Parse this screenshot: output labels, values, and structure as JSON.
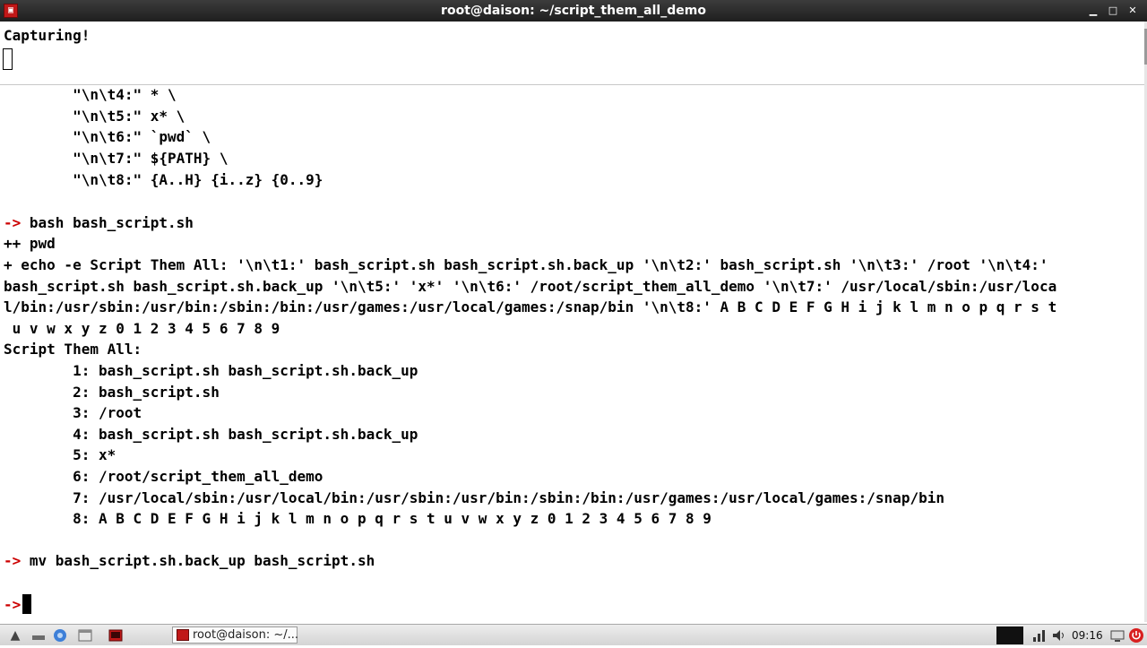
{
  "window": {
    "title": "root@daison: ~/script_them_all_demo",
    "min_glyph": "▁",
    "max_glyph": "□",
    "close_glyph": "✕"
  },
  "capture_pane": {
    "text": "Capturing!"
  },
  "terminal": {
    "script_lines": [
      "        \"\\n\\t4:\" * \\",
      "        \"\\n\\t5:\" x* \\",
      "        \"\\n\\t6:\" `pwd` \\",
      "        \"\\n\\t7:\" ${PATH} \\",
      "        \"\\n\\t8:\" {A..H} {i..z} {0..9}"
    ],
    "prompt": "->",
    "command1": " bash bash_script.sh",
    "trace_lines": [
      "++ pwd",
      "+ echo -e Script Them All: '\\n\\t1:' bash_script.sh bash_script.sh.back_up '\\n\\t2:' bash_script.sh '\\n\\t3:' /root '\\n\\t4:'",
      "bash_script.sh bash_script.sh.back_up '\\n\\t5:' 'x*' '\\n\\t6:' /root/script_them_all_demo '\\n\\t7:' /usr/local/sbin:/usr/loca",
      "l/bin:/usr/sbin:/usr/bin:/sbin:/bin:/usr/games:/usr/local/games:/snap/bin '\\n\\t8:' A B C D E F G H i j k l m n o p q r s t",
      " u v w x y z 0 1 2 3 4 5 6 7 8 9"
    ],
    "output_lines": [
      "Script Them All:",
      "        1: bash_script.sh bash_script.sh.back_up",
      "        2: bash_script.sh",
      "        3: /root",
      "        4: bash_script.sh bash_script.sh.back_up",
      "        5: x*",
      "        6: /root/script_them_all_demo",
      "        7: /usr/local/sbin:/usr/local/bin:/usr/sbin:/usr/bin:/sbin:/bin:/usr/games:/usr/local/games:/snap/bin",
      "        8: A B C D E F G H i j k l m n o p q r s t u v w x y z 0 1 2 3 4 5 6 7 8 9"
    ],
    "command2": " mv bash_script.sh.back_up bash_script.sh"
  },
  "taskbar": {
    "start_glyph": "▲",
    "task_label": "root@daison: ~/...",
    "clock": "09:16",
    "icon_names": [
      "start-menu-icon",
      "show-desktop-icon",
      "browser-icon",
      "file-manager-icon",
      "terminal-launcher-icon"
    ]
  },
  "colors": {
    "prompt": "#cc0000",
    "titlebar": "#2a2a2a",
    "terminal_bg": "#ffffff"
  }
}
